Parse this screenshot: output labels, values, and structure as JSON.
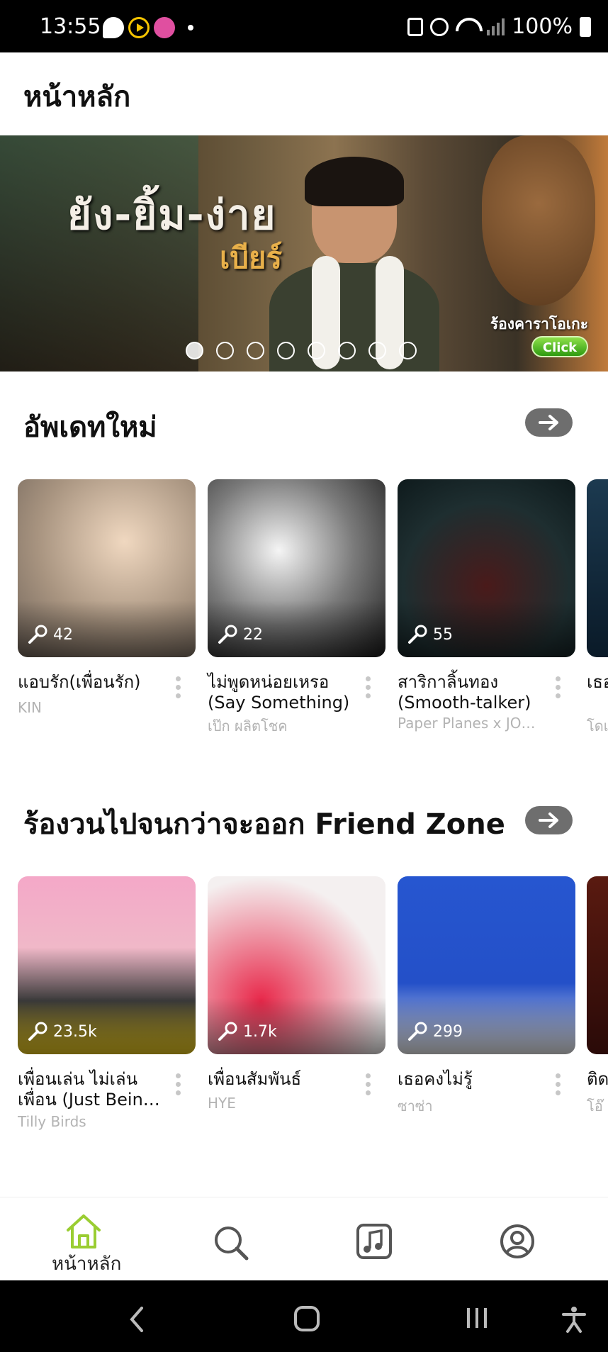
{
  "status_bar": {
    "time": "13:55",
    "battery": "100%"
  },
  "header": {
    "title": "หน้าหลัก"
  },
  "banner": {
    "title": "ยัง-ยิ้ม-ง่าย",
    "subtitle": "เบียร์",
    "cta_text": "ร้องคาราโอเกะ",
    "cta_button": "Click",
    "slide_count": 8,
    "active_slide": 1
  },
  "sections": [
    {
      "title": "อัพเดทใหม่",
      "items": [
        {
          "title": "แอบรัก(เพื่อนรัก)",
          "artist": "KIN",
          "count": "42"
        },
        {
          "title": "ไม่พูดหน่อยเหรอ (Say Something)",
          "artist": "เป๊ก ผลิตโชค",
          "count": "22"
        },
        {
          "title": "สาริกาลิ้นทอง (Smooth-talker)",
          "artist": "Paper Planes x JO…",
          "count": "55"
        },
        {
          "title": "เธอ (Ra",
          "artist": "โดเ",
          "count": ""
        }
      ]
    },
    {
      "title": "ร้องวนไปจนกว่าจะออก Friend Zone",
      "items": [
        {
          "title": "เพื่อนเล่น ไม่เล่นเพื่อน (Just Bein…",
          "artist": "Tilly Birds",
          "count": "23.5k"
        },
        {
          "title": "เพื่อนสัมพันธ์",
          "artist": "HYE",
          "count": "1.7k"
        },
        {
          "title": "เธอคงไม่รู้",
          "artist": "ซาซ่า",
          "count": "299"
        },
        {
          "title": "ติด",
          "artist": "โอ๊",
          "count": ""
        }
      ]
    }
  ],
  "bottom_nav": {
    "active_label": "หน้าหลัก",
    "items": [
      "home-icon",
      "search-icon",
      "music-library-icon",
      "profile-icon"
    ],
    "accent_color": "#9acd32"
  }
}
